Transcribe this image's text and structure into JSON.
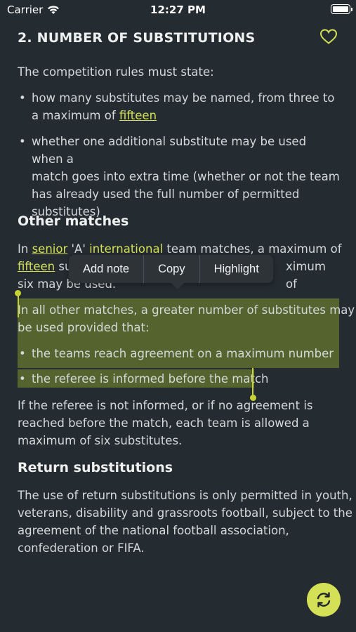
{
  "status_bar": {
    "carrier": "Carrier",
    "time": "12:27 PM"
  },
  "header": {
    "title": "2. NUMBER OF SUBSTITUTIONS",
    "favorite_icon": "heart-outline-icon"
  },
  "section1": {
    "intro": "The competition rules must state:",
    "bullets": [
      {
        "text_before": "how many substitutes may be named, from three to a maximum of ",
        "link": "fifteen",
        "text_after": ""
      },
      {
        "line1": "whether one additional substitute may be used when a",
        "line2": "match goes into extra time (whether or not the team",
        "line3": "has already used the full number of permitted",
        "line4": "substitutes)"
      }
    ]
  },
  "section2": {
    "heading": "Other matches",
    "para1": {
      "t1": "In ",
      "link1": "senior",
      "t2": " 'A' ",
      "link2": "international",
      "t3": " team matches, a maximum of",
      "link3": "fifteen",
      "t4": " su",
      "t5": "ximum of",
      "line3": "six may be used."
    },
    "selected_para_line1": "In all other matches, a greater number of substitutes may",
    "selected_para_line2": "be used provided that:",
    "bullets": [
      "the teams reach agreement on a maximum number",
      "the referee is informed before the match"
    ],
    "para2_line1": "If the referee is not informed, or if no agreement is",
    "para2_line2": "reached before the match, each team is allowed a",
    "para2_line3": "maximum of six substitutes."
  },
  "section3": {
    "heading": "Return substitutions",
    "line1": "The use of return substitutions is only permitted in youth,",
    "line2": "veterans, disability and grassroots football, subject to the",
    "line3": "agreement of the national football association,",
    "line4": "confederation or FIFA."
  },
  "context_menu": {
    "items": [
      "Add note",
      "Copy",
      "Highlight"
    ]
  },
  "fab": {
    "icon": "refresh-icon"
  },
  "colors": {
    "background": "#242b31",
    "accent": "#d4e157",
    "selection": "#55632e"
  }
}
